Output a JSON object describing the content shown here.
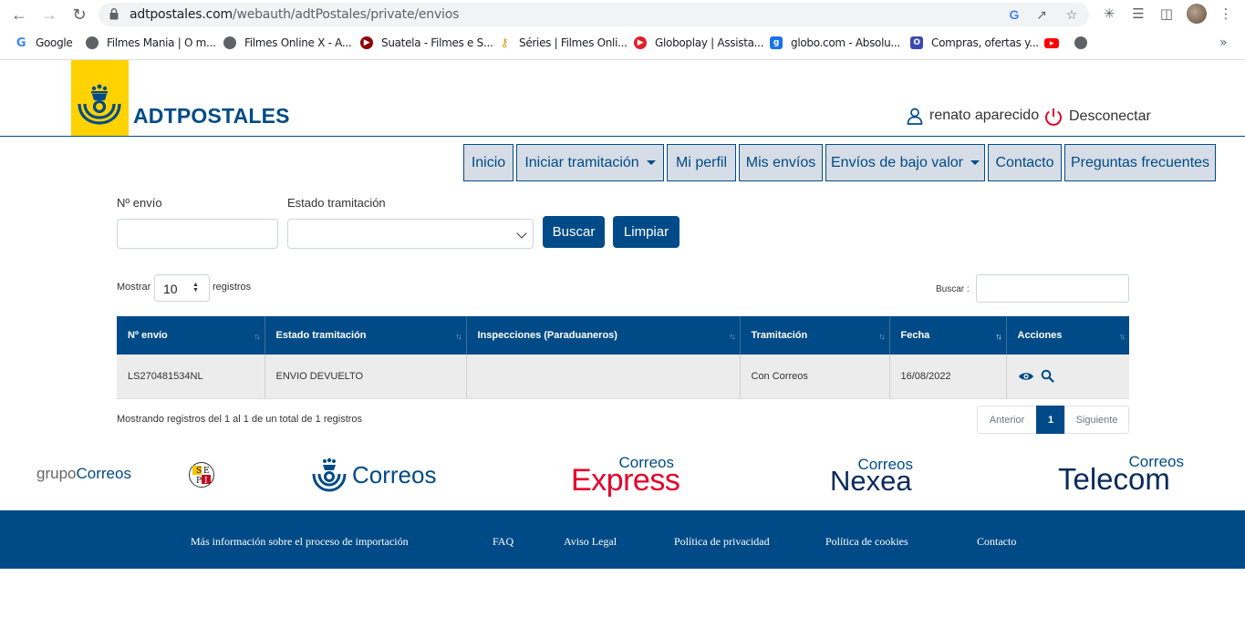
{
  "browser": {
    "url_domain": "adtpostales.com",
    "url_path": "/webauth/adtPostales/private/envios",
    "bookmarks": [
      {
        "label": "Google",
        "icon": "google-icon",
        "color": "#ffffff"
      },
      {
        "label": "Filmes Mania | O m...",
        "icon": "globe-icon",
        "color": "#5f6368"
      },
      {
        "label": "Filmes Online X - A...",
        "icon": "globe-icon",
        "color": "#5f6368"
      },
      {
        "label": "Suatela - Filmes e S...",
        "icon": "play-icon",
        "color": "#8b0000"
      },
      {
        "label": "Séries | Filmes Onli...",
        "icon": "key-icon",
        "color": "#d4a017"
      },
      {
        "label": "Globoplay | Assista...",
        "icon": "globoplay-icon",
        "color": "#e01e24"
      },
      {
        "label": "globo.com - Absolu...",
        "icon": "g-icon",
        "color": "#1a73e8"
      },
      {
        "label": "Compras, ofertas y...",
        "icon": "shopping-icon",
        "color": "#3c48b3"
      }
    ]
  },
  "header": {
    "brand": "ADTPOSTALES",
    "user_name": "renato aparecido",
    "logout_label": "Desconectar"
  },
  "menu": [
    {
      "label": "Inicio",
      "dropdown": false
    },
    {
      "label": "Iniciar tramitación",
      "dropdown": true
    },
    {
      "label": "Mi perfil",
      "dropdown": false
    },
    {
      "label": "Mis envíos",
      "dropdown": false
    },
    {
      "label": "Envíos de bajo valor",
      "dropdown": true
    },
    {
      "label": "Contacto",
      "dropdown": false
    },
    {
      "label": "Preguntas frecuentes",
      "dropdown": false
    }
  ],
  "filters": {
    "envio_label": "Nº envío",
    "envio_value": "",
    "estado_label": "Estado tramitación",
    "estado_value": "",
    "search_button": "Buscar",
    "clear_button": "Limpiar"
  },
  "table_controls": {
    "show_label": "Mostrar",
    "show_value": "10",
    "records_label": "registros",
    "search_label": "Buscar :",
    "search_value": ""
  },
  "table": {
    "columns": [
      "Nº envío",
      "Estado tramitación",
      "Inspecciones (Paraduaneros)",
      "Tramitación",
      "Fecha",
      "Acciones"
    ],
    "rows": [
      {
        "envio": "LS270481534NL",
        "estado": "ENVIO DEVUELTO",
        "inspecciones": "",
        "tramitacion": "Con Correos",
        "fecha": "16/08/2022"
      }
    ]
  },
  "summary": "Mostrando registros del 1 al 1 de un total de 1 registros",
  "pagination": {
    "prev": "Anterior",
    "current": "1",
    "next": "Siguiente"
  },
  "partners": {
    "grupo_prefix": "grupo",
    "grupo_name": "Correos",
    "sepi": "SEPI",
    "correos": "Correos",
    "express_top": "Correos",
    "express_bottom": "Express",
    "nexea_top": "Correos",
    "nexea_bottom": "Nexea",
    "telecom_top": "Correos",
    "telecom_bottom": "Telecom"
  },
  "footer": {
    "links": [
      "Más información sobre el proceso de importación",
      "FAQ",
      "Aviso Legal",
      "Política de privacidad",
      "Política de cookies",
      "Contacto"
    ]
  },
  "colors": {
    "brand_blue": "#004b87",
    "brand_yellow": "#ffd200",
    "express_red": "#e4002b"
  }
}
